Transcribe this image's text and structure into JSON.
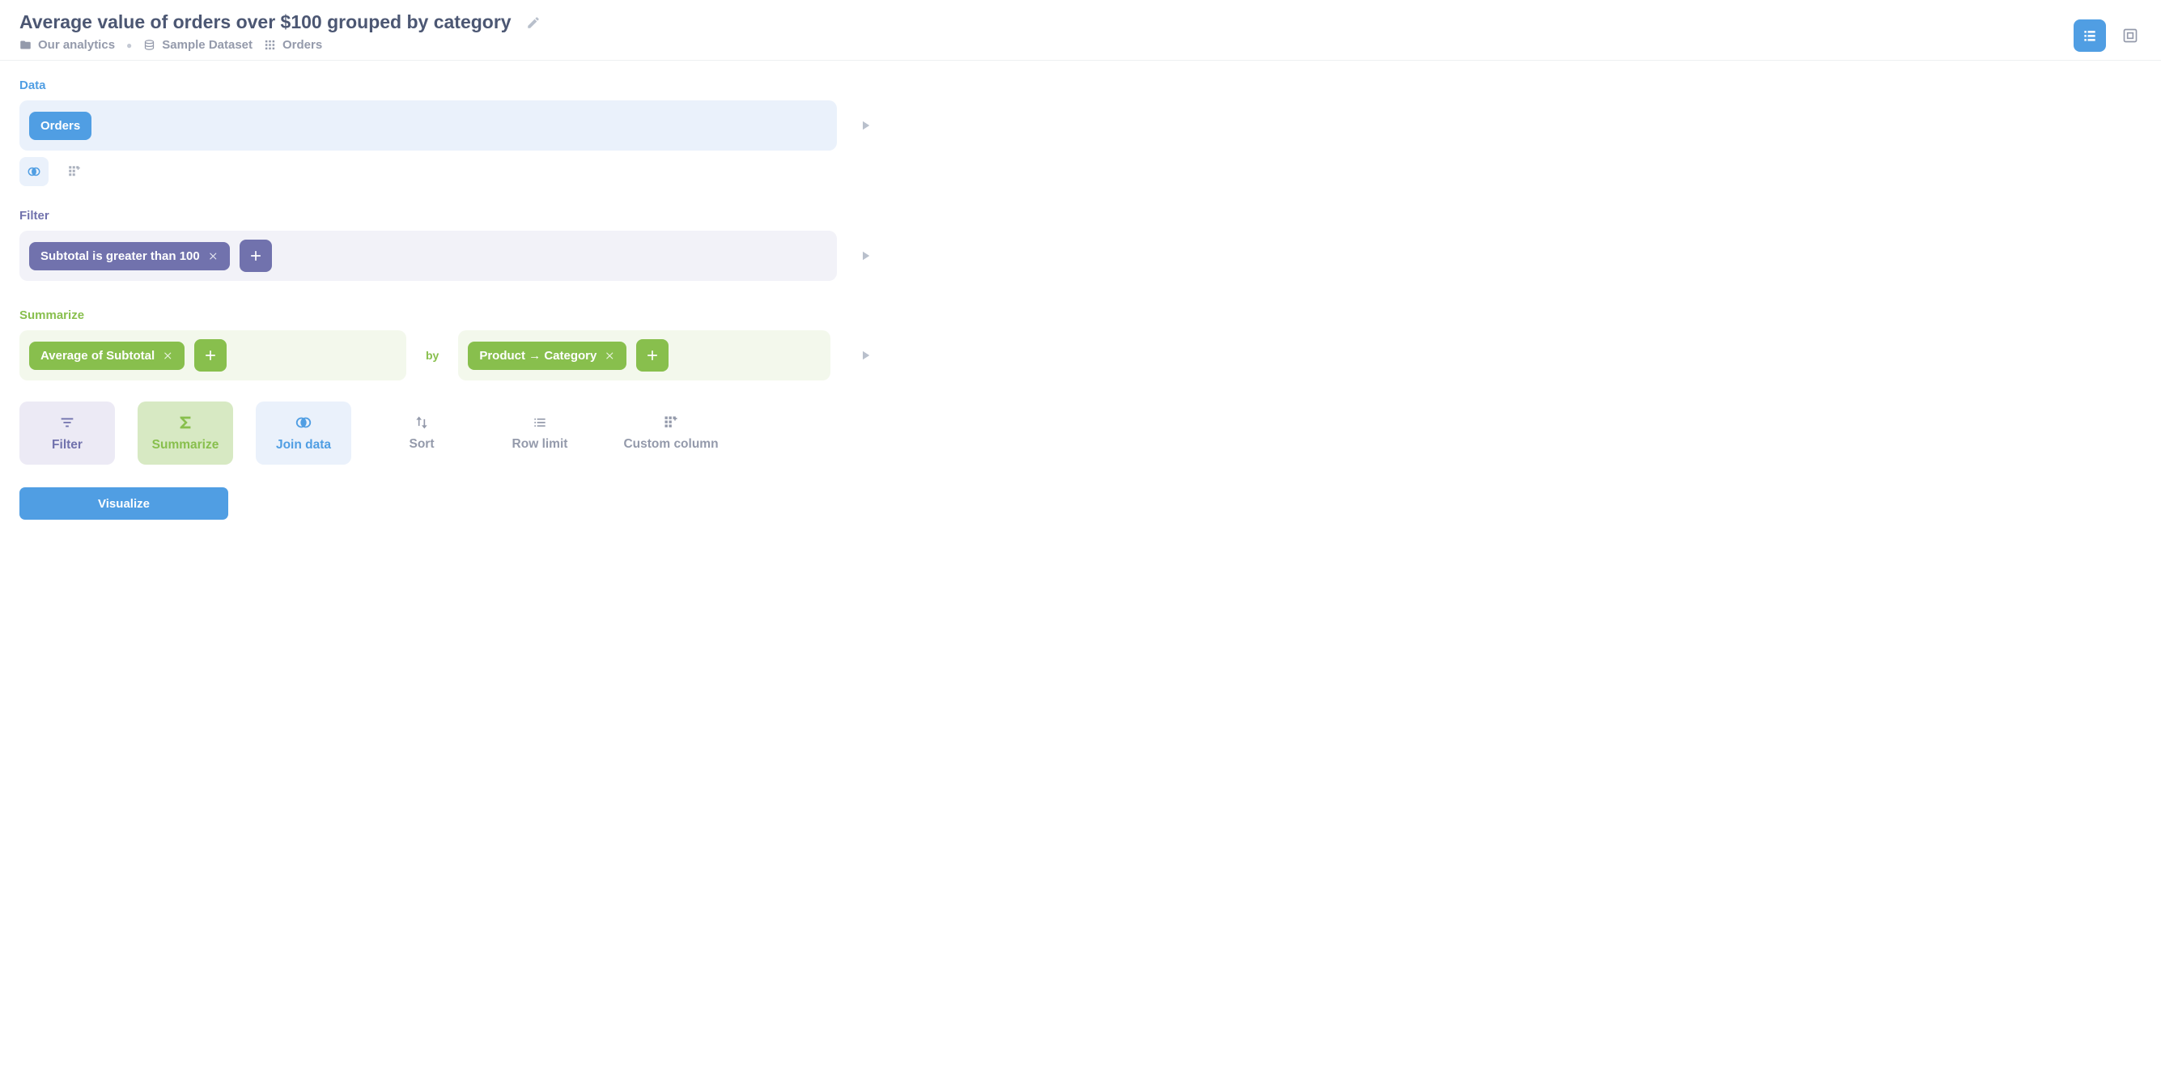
{
  "header": {
    "title": "Average value of orders over $100 grouped by category",
    "breadcrumbs": {
      "collection": "Our analytics",
      "database": "Sample Dataset",
      "table": "Orders"
    }
  },
  "sections": {
    "data_label": "Data",
    "filter_label": "Filter",
    "summarize_label": "Summarize",
    "by_label": "by"
  },
  "data": {
    "source": "Orders"
  },
  "filter": {
    "pill": "Subtotal is greater than 100"
  },
  "summarize": {
    "aggregation": "Average of Subtotal",
    "breakout": "Product → Category"
  },
  "step_buttons": {
    "filter": "Filter",
    "summarize": "Summarize",
    "join": "Join data",
    "sort": "Sort",
    "row_limit": "Row limit",
    "custom_column": "Custom column"
  },
  "visualize": "Visualize"
}
